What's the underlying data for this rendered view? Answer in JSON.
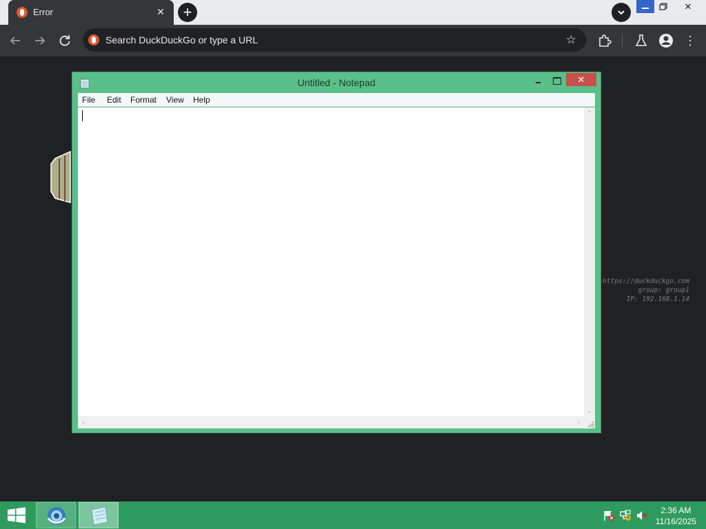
{
  "browser": {
    "tab_title": "Error",
    "tab_close": "✕",
    "new_tab": "+",
    "window_close": "✕",
    "omnibox_placeholder": "Search DuckDuckGo or type a URL",
    "favicon_color": "#de5833"
  },
  "page": {
    "meta_url": "https://duckduckgo.com",
    "meta_group": "group: group1",
    "meta_ip": "IP: 192.168.1.14"
  },
  "notepad": {
    "title": "Untitled - Notepad",
    "close_glyph": "✕",
    "menu": [
      "File",
      "Edit",
      "Format",
      "View",
      "Help"
    ],
    "content": "",
    "frame_color": "#5abf89"
  },
  "taskbar": {
    "time": "2:36 AM",
    "date": "11/16/2025",
    "color": "#2e9a5e"
  }
}
